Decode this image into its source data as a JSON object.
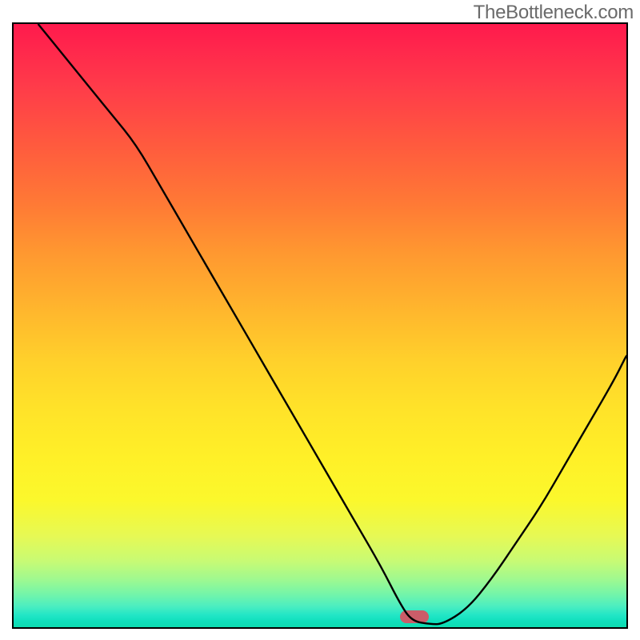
{
  "watermark": "TheBottleneck.com",
  "chart_data": {
    "type": "line",
    "title": "",
    "xlabel": "",
    "ylabel": "",
    "xlim": [
      0,
      100
    ],
    "ylim": [
      0,
      100
    ],
    "grid": false,
    "legend": false,
    "x": [
      4,
      8,
      12,
      16,
      20,
      24,
      28,
      32,
      36,
      40,
      44,
      48,
      52,
      56,
      60,
      63,
      65,
      68,
      70,
      74,
      78,
      82,
      86,
      90,
      94,
      98,
      100
    ],
    "values": [
      100,
      95,
      90,
      85,
      80,
      73,
      66,
      59,
      52,
      45,
      38,
      31,
      24,
      17,
      10,
      4,
      1,
      0.5,
      0.5,
      3,
      8,
      14,
      20,
      27,
      34,
      41,
      45
    ],
    "notes": "V-shaped bottleneck curve; y-axis is mismatch percentage (100 = worst, 0 = optimal). Background is a vertical reddish-to-green gradient indicating quality. A small rounded marker sits at the curve minimum around x≈67."
  },
  "marker": {
    "x_percent": 67,
    "y_percent": 0.5,
    "color": "#cb5d69"
  },
  "colors": {
    "top": "#ff1a4d",
    "mid": "#ffe329",
    "bottom": "#0edcb0",
    "curve": "#000000",
    "border": "#000000",
    "watermark": "#6a6a6a"
  }
}
